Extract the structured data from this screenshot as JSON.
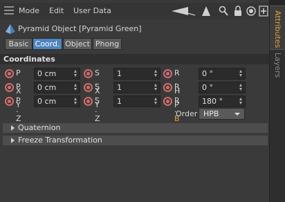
{
  "menu": {
    "mode": "Mode",
    "edit": "Edit",
    "user_data": "User Data"
  },
  "toolbar_icons": [
    "back-arrow-icon",
    "up-arrow-icon",
    "search-icon",
    "lock-icon",
    "target-icon",
    "new-panel-icon"
  ],
  "object": {
    "title": "Pyramid Object [Pyramid Green]"
  },
  "tabs": [
    {
      "label": "Basic",
      "active": false
    },
    {
      "label": "Coord.",
      "active": true
    },
    {
      "label": "Object",
      "active": false
    },
    {
      "label": "Phong",
      "active": false
    }
  ],
  "section": {
    "title": "Coordinates"
  },
  "params": {
    "px": {
      "label": "P . X",
      "value": "0 cm"
    },
    "py": {
      "label": "P . Y",
      "value": "0 cm"
    },
    "pz": {
      "label": "P . Z",
      "value": "0 cm"
    },
    "sx": {
      "label": "S . X",
      "value": "1"
    },
    "sy": {
      "label": "S . Y",
      "value": "1"
    },
    "sz": {
      "label": "S . Z",
      "value": "1"
    },
    "rh": {
      "label": "R . H",
      "value": "0 °"
    },
    "rp": {
      "label": "R . P",
      "value": "0 °"
    },
    "rb": {
      "label_prefix": "R . ",
      "label_highlight": "B",
      "value": "180 °"
    }
  },
  "order": {
    "label": "Order",
    "value": "HPB"
  },
  "groups": {
    "quaternion": "Quaternion",
    "freeze": "Freeze Transformation"
  },
  "side_tabs": {
    "attributes": "Attributes",
    "layers": "Layers"
  },
  "colors": {
    "active_tab": "#4d84bf",
    "keyframe_radio": "#d86b6b",
    "highlight": "#e3a331"
  }
}
